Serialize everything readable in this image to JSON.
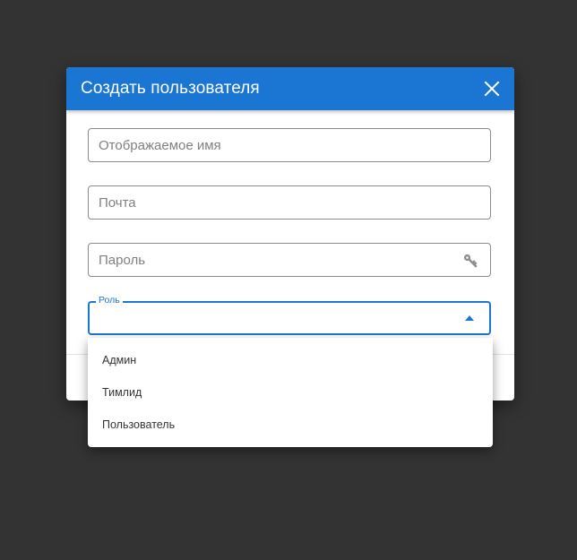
{
  "dialog": {
    "title": "Создать пользователя",
    "close_icon": "close-icon"
  },
  "form": {
    "display_name": {
      "placeholder": "Отображаемое имя",
      "value": ""
    },
    "email": {
      "placeholder": "Почта",
      "value": ""
    },
    "password": {
      "placeholder": "Пароль",
      "value": "",
      "icon": "key-icon"
    },
    "role": {
      "label": "Роль",
      "value": "",
      "icon": "caret-up-icon",
      "expanded": true
    }
  },
  "role_options": [
    {
      "label": "Админ"
    },
    {
      "label": "Тимлид"
    },
    {
      "label": "Пользователь"
    }
  ],
  "colors": {
    "backdrop": "#333333",
    "header": "#1a76d2",
    "accent": "#1a76d2",
    "field_border": "#8a8a8a",
    "placeholder": "#808080"
  }
}
